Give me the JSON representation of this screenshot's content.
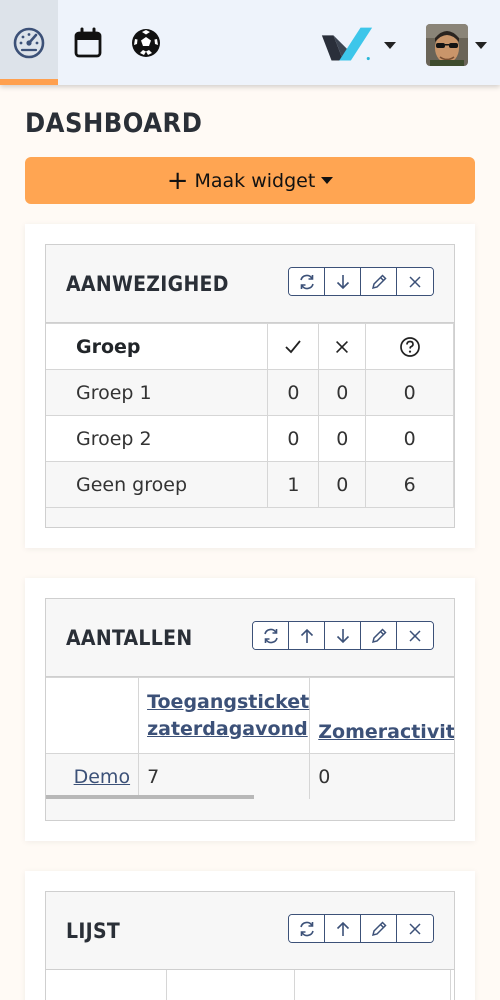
{
  "page": {
    "title": "DASHBOARD"
  },
  "nav": {
    "tabs": [
      {
        "name": "dashboard",
        "icon": "gauge-icon",
        "active": true
      },
      {
        "name": "calendar",
        "icon": "calendar-icon",
        "active": false
      },
      {
        "name": "sport",
        "icon": "soccer-ball-icon",
        "active": false
      }
    ],
    "accent": "#ffa04f"
  },
  "make_widget": {
    "label": "Maak widget"
  },
  "widgets": {
    "aanwezigheid": {
      "title": "AANWEZIGHED",
      "headers": {
        "group": "Groep",
        "present_icon": "check-icon",
        "absent_icon": "x-icon",
        "unknown_icon": "question-circle-icon"
      },
      "rows": [
        {
          "group": "Groep 1",
          "present": "0",
          "absent": "0",
          "unknown": "0"
        },
        {
          "group": "Groep 2",
          "present": "0",
          "absent": "0",
          "unknown": "0"
        },
        {
          "group": "Geen groep",
          "present": "1",
          "absent": "0",
          "unknown": "6"
        }
      ]
    },
    "aantallen": {
      "title": "AANTALLEN",
      "columns": [
        "Toegangsticket zaterdagavond",
        "Zomeractiviteit"
      ],
      "column_lines": [
        [
          "Toegangsticket",
          "zaterdagavond"
        ],
        [
          "Zomeractivite"
        ]
      ],
      "rows": [
        {
          "label": "Demo",
          "values": [
            "7",
            "0"
          ]
        }
      ]
    },
    "lijst": {
      "title": "LIJST"
    }
  },
  "colors": {
    "primary": "#3c5178",
    "orange": "#ffa552",
    "background": "#fffaf5"
  }
}
